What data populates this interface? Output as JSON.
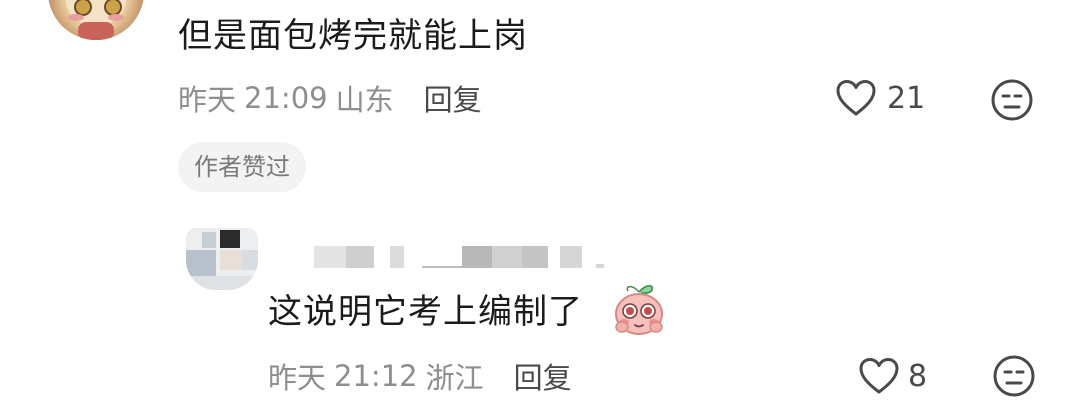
{
  "comments": [
    {
      "text": "但是面包烤完就能上岗",
      "date": "昨天",
      "time": "21:09",
      "location": "山东",
      "reply_label": "回复",
      "likes": "21",
      "author_badge": "作者赞过"
    },
    {
      "text": "这说明它考上编制了",
      "date": "昨天",
      "time": "21:12",
      "location": "浙江",
      "reply_label": "回复",
      "likes": "8"
    }
  ],
  "icons": {
    "like": "heart-outline-icon",
    "dislike": "neutral-face-icon",
    "emoji": "blushing-pink-emoji"
  },
  "colors": {
    "text_primary": "#1b1b1b",
    "text_meta": "#8e8e8e",
    "icon": "#4a4a4a",
    "badge_bg": "#f3f3f3",
    "badge_text": "#7a7a7a"
  }
}
